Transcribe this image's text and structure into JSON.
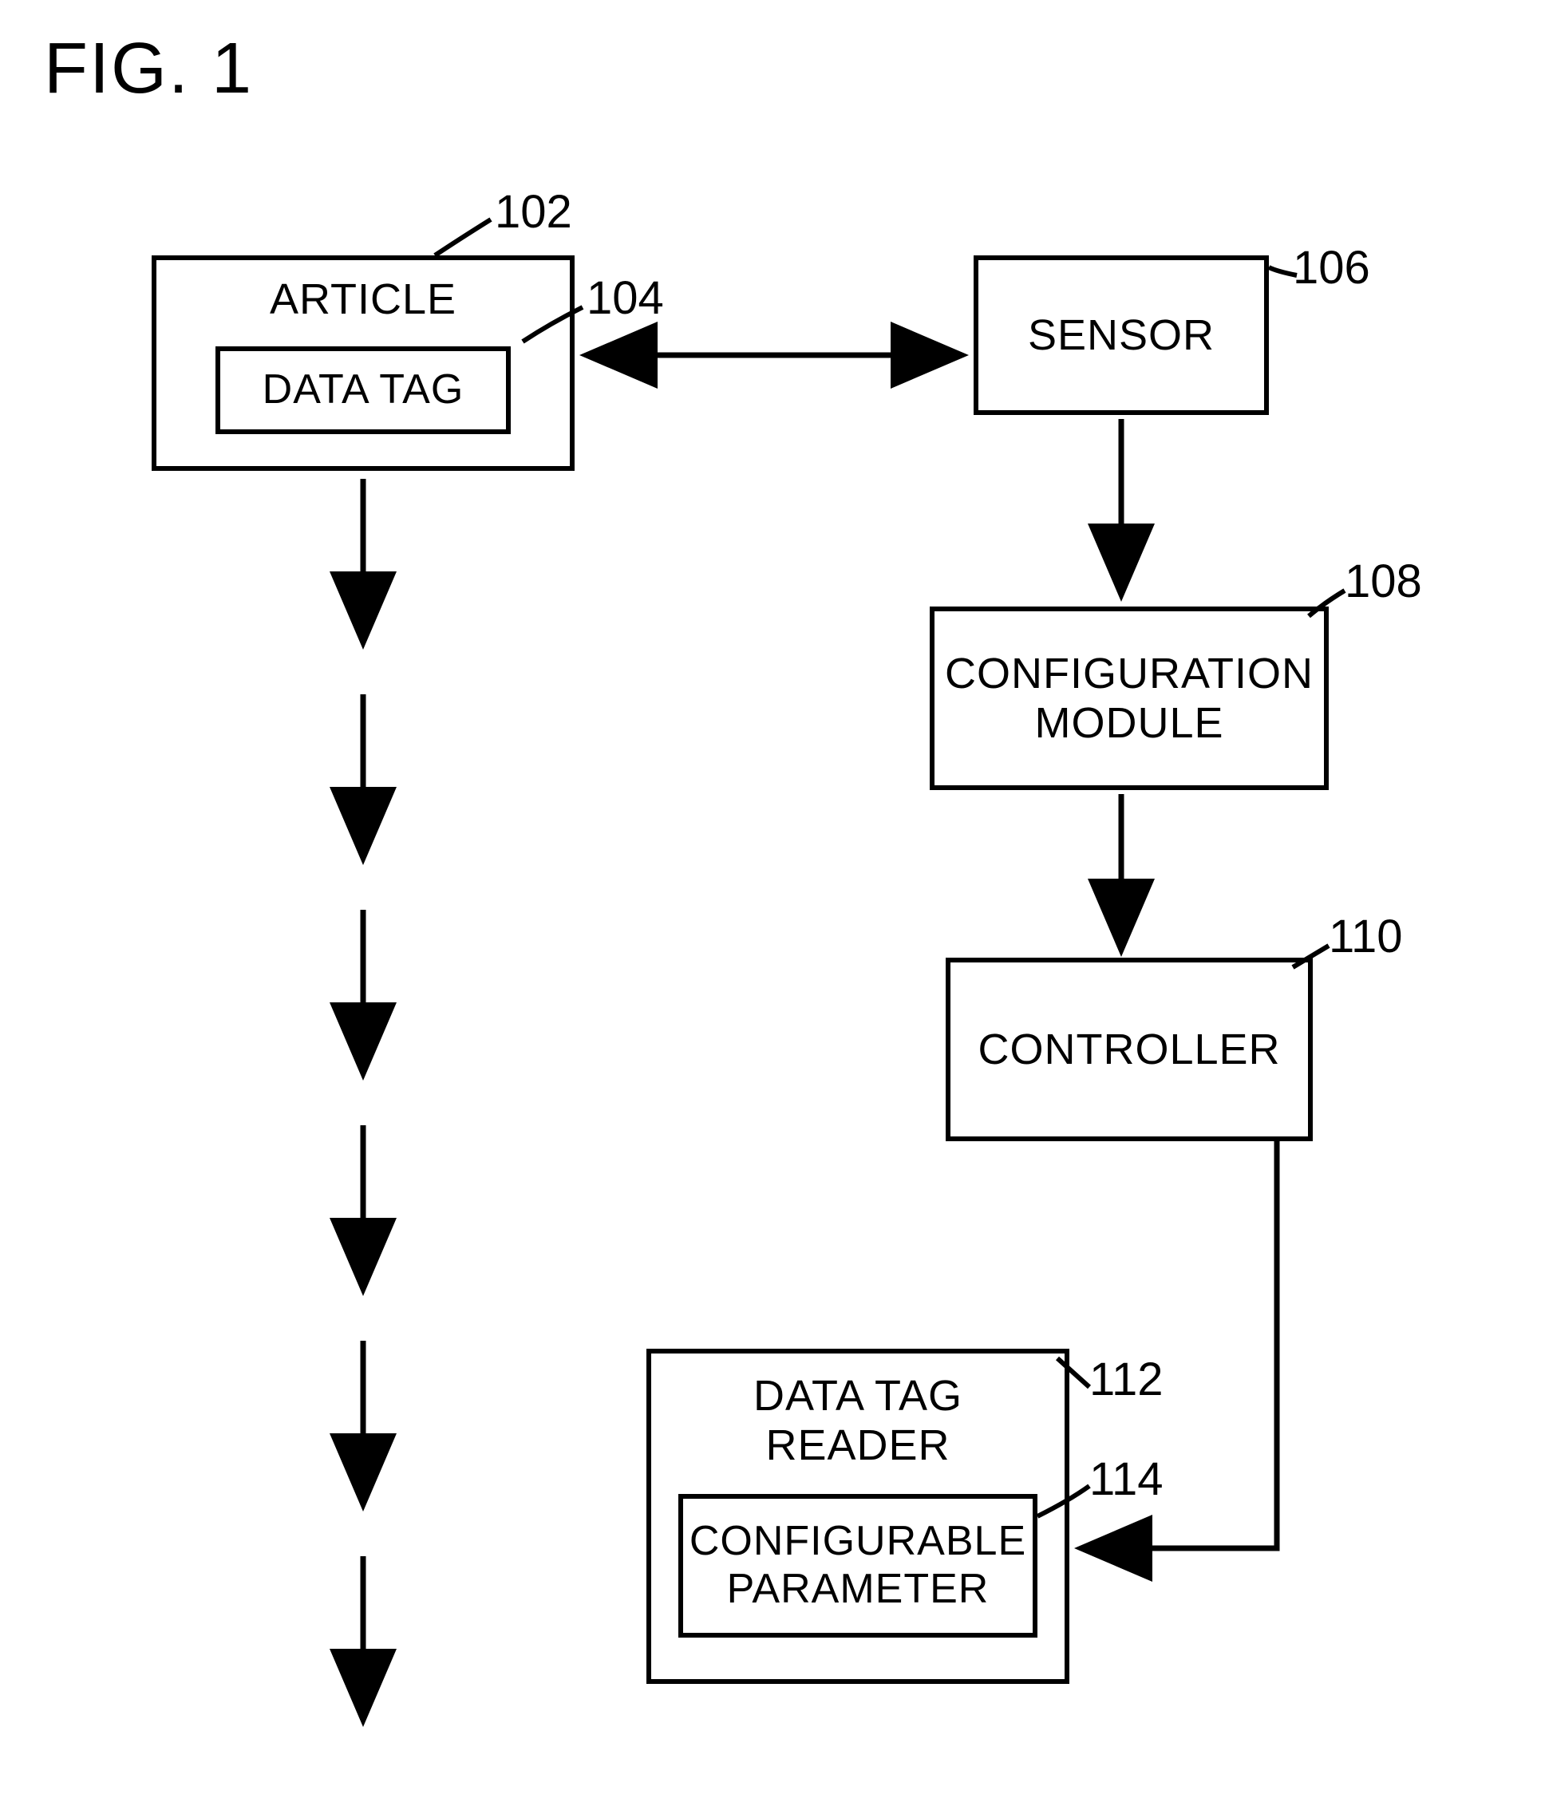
{
  "figure_title": "FIG. 1",
  "boxes": {
    "article": {
      "label": "ARTICLE",
      "ref": "102"
    },
    "data_tag": {
      "label": "DATA TAG",
      "ref": "104"
    },
    "sensor": {
      "label": "SENSOR",
      "ref": "106"
    },
    "config_module": {
      "label": "CONFIGURATION\nMODULE",
      "ref": "108"
    },
    "controller": {
      "label": "CONTROLLER",
      "ref": "110"
    },
    "reader": {
      "label": "DATA TAG\nREADER",
      "ref": "112"
    },
    "config_param": {
      "label": "CONFIGURABLE\nPARAMETER",
      "ref": "114"
    }
  }
}
